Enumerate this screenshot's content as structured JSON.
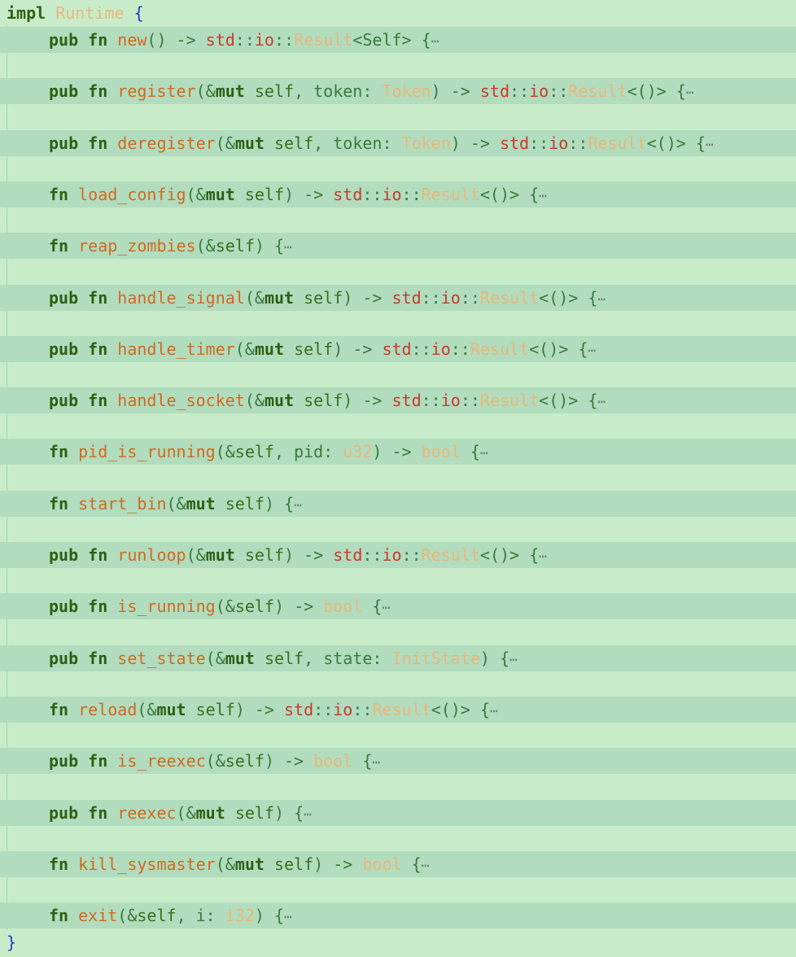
{
  "header": {
    "impl": "impl",
    "name": "Runtime",
    "open": "{"
  },
  "footer": {
    "close": "}"
  },
  "fold_marker": "⋯",
  "tokens": [
    [
      [
        "kw",
        "pub fn "
      ],
      [
        "fn",
        "new"
      ],
      [
        "p",
        "() -> "
      ],
      [
        "ns",
        "std"
      ],
      [
        "p",
        "::"
      ],
      [
        "ns",
        "io"
      ],
      [
        "p",
        "::"
      ],
      [
        "ty",
        "Result"
      ],
      [
        "p",
        "<Self> "
      ],
      [
        "p",
        "{"
      ]
    ],
    [
      [
        "kw",
        "pub fn "
      ],
      [
        "fn",
        "register"
      ],
      [
        "p",
        "(&"
      ],
      [
        "kw",
        "mut "
      ],
      [
        "sf",
        "self"
      ],
      [
        "p",
        ", token: "
      ],
      [
        "ty",
        "Token"
      ],
      [
        "p",
        ") -> "
      ],
      [
        "ns",
        "std"
      ],
      [
        "p",
        "::"
      ],
      [
        "ns",
        "io"
      ],
      [
        "p",
        "::"
      ],
      [
        "ty",
        "Result"
      ],
      [
        "p",
        "<()> "
      ],
      [
        "p",
        "{"
      ]
    ],
    [
      [
        "kw",
        "pub fn "
      ],
      [
        "fn",
        "deregister"
      ],
      [
        "p",
        "(&"
      ],
      [
        "kw",
        "mut "
      ],
      [
        "sf",
        "self"
      ],
      [
        "p",
        ", token: "
      ],
      [
        "ty",
        "Token"
      ],
      [
        "p",
        ") -> "
      ],
      [
        "ns",
        "std"
      ],
      [
        "p",
        "::"
      ],
      [
        "ns",
        "io"
      ],
      [
        "p",
        "::"
      ],
      [
        "ty",
        "Result"
      ],
      [
        "p",
        "<()> "
      ],
      [
        "p",
        "{"
      ]
    ],
    [
      [
        "kw",
        "fn "
      ],
      [
        "fn",
        "load_config"
      ],
      [
        "p",
        "(&"
      ],
      [
        "kw",
        "mut "
      ],
      [
        "sf",
        "self"
      ],
      [
        "p",
        ") -> "
      ],
      [
        "ns",
        "std"
      ],
      [
        "p",
        "::"
      ],
      [
        "ns",
        "io"
      ],
      [
        "p",
        "::"
      ],
      [
        "ty",
        "Result"
      ],
      [
        "p",
        "<()> "
      ],
      [
        "p",
        "{"
      ]
    ],
    [
      [
        "kw",
        "fn "
      ],
      [
        "fn",
        "reap_zombies"
      ],
      [
        "p",
        "(&"
      ],
      [
        "sf",
        "self"
      ],
      [
        "p",
        ") "
      ],
      [
        "p",
        "{"
      ]
    ],
    [
      [
        "kw",
        "pub fn "
      ],
      [
        "fn",
        "handle_signal"
      ],
      [
        "p",
        "(&"
      ],
      [
        "kw",
        "mut "
      ],
      [
        "sf",
        "self"
      ],
      [
        "p",
        ") -> "
      ],
      [
        "ns",
        "std"
      ],
      [
        "p",
        "::"
      ],
      [
        "ns",
        "io"
      ],
      [
        "p",
        "::"
      ],
      [
        "ty",
        "Result"
      ],
      [
        "p",
        "<()> "
      ],
      [
        "p",
        "{"
      ]
    ],
    [
      [
        "kw",
        "pub fn "
      ],
      [
        "fn",
        "handle_timer"
      ],
      [
        "p",
        "(&"
      ],
      [
        "kw",
        "mut "
      ],
      [
        "sf",
        "self"
      ],
      [
        "p",
        ") -> "
      ],
      [
        "ns",
        "std"
      ],
      [
        "p",
        "::"
      ],
      [
        "ns",
        "io"
      ],
      [
        "p",
        "::"
      ],
      [
        "ty",
        "Result"
      ],
      [
        "p",
        "<()> "
      ],
      [
        "p",
        "{"
      ]
    ],
    [
      [
        "kw",
        "pub fn "
      ],
      [
        "fn",
        "handle_socket"
      ],
      [
        "p",
        "(&"
      ],
      [
        "kw",
        "mut "
      ],
      [
        "sf",
        "self"
      ],
      [
        "p",
        ") -> "
      ],
      [
        "ns",
        "std"
      ],
      [
        "p",
        "::"
      ],
      [
        "ns",
        "io"
      ],
      [
        "p",
        "::"
      ],
      [
        "ty",
        "Result"
      ],
      [
        "p",
        "<()> "
      ],
      [
        "p",
        "{"
      ]
    ],
    [
      [
        "kw",
        "fn "
      ],
      [
        "fn",
        "pid_is_running"
      ],
      [
        "p",
        "(&"
      ],
      [
        "sf",
        "self"
      ],
      [
        "p",
        ", pid: "
      ],
      [
        "ty",
        "u32"
      ],
      [
        "p",
        ") -> "
      ],
      [
        "ty",
        "bool"
      ],
      [
        "p",
        " "
      ],
      [
        "p",
        "{"
      ]
    ],
    [
      [
        "kw",
        "fn "
      ],
      [
        "fn",
        "start_bin"
      ],
      [
        "p",
        "(&"
      ],
      [
        "kw",
        "mut "
      ],
      [
        "sf",
        "self"
      ],
      [
        "p",
        ") "
      ],
      [
        "p",
        "{"
      ]
    ],
    [
      [
        "kw",
        "pub fn "
      ],
      [
        "fn",
        "runloop"
      ],
      [
        "p",
        "(&"
      ],
      [
        "kw",
        "mut "
      ],
      [
        "sf",
        "self"
      ],
      [
        "p",
        ") -> "
      ],
      [
        "ns",
        "std"
      ],
      [
        "p",
        "::"
      ],
      [
        "ns",
        "io"
      ],
      [
        "p",
        "::"
      ],
      [
        "ty",
        "Result"
      ],
      [
        "p",
        "<()> "
      ],
      [
        "p",
        "{"
      ]
    ],
    [
      [
        "kw",
        "pub fn "
      ],
      [
        "fn",
        "is_running"
      ],
      [
        "p",
        "(&"
      ],
      [
        "sf",
        "self"
      ],
      [
        "p",
        ") -> "
      ],
      [
        "ty",
        "bool"
      ],
      [
        "p",
        " "
      ],
      [
        "p",
        "{"
      ]
    ],
    [
      [
        "kw",
        "pub fn "
      ],
      [
        "fn",
        "set_state"
      ],
      [
        "p",
        "(&"
      ],
      [
        "kw",
        "mut "
      ],
      [
        "sf",
        "self"
      ],
      [
        "p",
        ", state: "
      ],
      [
        "ty",
        "InitState"
      ],
      [
        "p",
        ") "
      ],
      [
        "p",
        "{"
      ]
    ],
    [
      [
        "kw",
        "fn "
      ],
      [
        "fn",
        "reload"
      ],
      [
        "p",
        "(&"
      ],
      [
        "kw",
        "mut "
      ],
      [
        "sf",
        "self"
      ],
      [
        "p",
        ") -> "
      ],
      [
        "ns",
        "std"
      ],
      [
        "p",
        "::"
      ],
      [
        "ns",
        "io"
      ],
      [
        "p",
        "::"
      ],
      [
        "ty",
        "Result"
      ],
      [
        "p",
        "<()> "
      ],
      [
        "p",
        "{"
      ]
    ],
    [
      [
        "kw",
        "pub fn "
      ],
      [
        "fn",
        "is_reexec"
      ],
      [
        "p",
        "(&"
      ],
      [
        "sf",
        "self"
      ],
      [
        "p",
        ") -> "
      ],
      [
        "ty",
        "bool"
      ],
      [
        "p",
        " "
      ],
      [
        "p",
        "{"
      ]
    ],
    [
      [
        "kw",
        "pub fn "
      ],
      [
        "fn",
        "reexec"
      ],
      [
        "p",
        "(&"
      ],
      [
        "kw",
        "mut "
      ],
      [
        "sf",
        "self"
      ],
      [
        "p",
        ") "
      ],
      [
        "p",
        "{"
      ]
    ],
    [
      [
        "kw",
        "fn "
      ],
      [
        "fn",
        "kill_sysmaster"
      ],
      [
        "p",
        "(&"
      ],
      [
        "kw",
        "mut "
      ],
      [
        "sf",
        "self"
      ],
      [
        "p",
        ") -> "
      ],
      [
        "ty",
        "bool"
      ],
      [
        "p",
        " "
      ],
      [
        "p",
        "{"
      ]
    ],
    [
      [
        "kw",
        "fn "
      ],
      [
        "fn",
        "exit"
      ],
      [
        "p",
        "(&"
      ],
      [
        "sf",
        "self"
      ],
      [
        "p",
        ", i: "
      ],
      [
        "ty",
        "i32"
      ],
      [
        "p",
        ") "
      ],
      [
        "p",
        "{"
      ]
    ]
  ]
}
